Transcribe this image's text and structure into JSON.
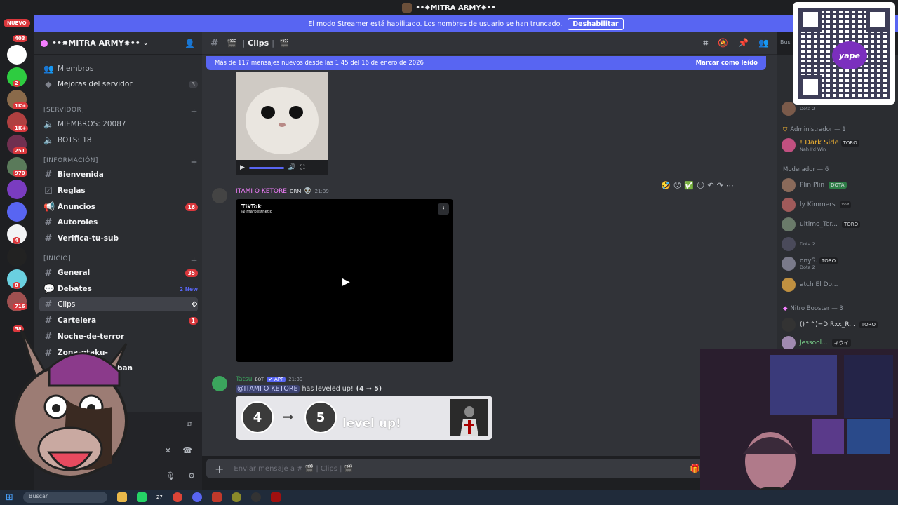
{
  "window": {
    "title": "••✸MITRA ARMY✸••"
  },
  "streamer_notice": {
    "text": "El modo Streamer está habilitado. Los nombres de usuario se han truncado.",
    "button": "Deshabilitar"
  },
  "rail": {
    "new_label": "NUEVO",
    "badges": [
      "403",
      "2",
      "1K+",
      "1K+",
      "251",
      "970",
      "4",
      "8",
      "716",
      "58"
    ]
  },
  "server": {
    "name": "••✸MITRA ARMY✸••"
  },
  "sidebar": {
    "top_items": [
      {
        "label": "Miembros"
      },
      {
        "label": "Mejoras del servidor",
        "count": "3"
      }
    ],
    "categories": {
      "servidor": "[SERVIDOR]",
      "informacion": "[INFORMACIÓN]",
      "inicio": "[INICIO]"
    },
    "servidor_items": [
      {
        "label": "MIEMBROS: 20087"
      },
      {
        "label": "BOTS: 18"
      }
    ],
    "info_channels": [
      {
        "emoji": "👋",
        "label": "Bienvenida"
      },
      {
        "emoji": "⛔",
        "label": "Reglas"
      },
      {
        "emoji": "◀",
        "label": "Anuncios",
        "count": "16"
      },
      {
        "emoji": "🗒",
        "label": "Autoroles"
      },
      {
        "emoji": "✅",
        "label": "Verifica-tu-sub"
      }
    ],
    "inicio_channels": [
      {
        "emoji": "🔵",
        "label": "General",
        "count": "35"
      },
      {
        "emoji": "",
        "label": "Debates",
        "new": "2 New"
      },
      {
        "emoji": "🎬",
        "label": "Clips"
      },
      {
        "emoji": "🍿",
        "label": "Cartelera",
        "count": "1"
      },
      {
        "emoji": "",
        "label": "Noche-de-terror"
      },
      {
        "emoji": "",
        "label": "Zona-otaku-"
      },
      {
        "emoji": "",
        "label": "unban"
      }
    ]
  },
  "chat_header": {
    "channel": "Clips",
    "search_placeholder": "Bus"
  },
  "new_messages_bar": {
    "text": "Más de 117 mensajes nuevos desde las 1:45 del 16 de enero de 2026",
    "mark": "Marcar como leído"
  },
  "message_tiktok": {
    "author": "ITAMI O KETORE",
    "badge": "ORM",
    "time": "21:39",
    "tiktok_brand": "TikTok",
    "tiktok_user": "@ marpesthetic"
  },
  "message_tatsu": {
    "author": "Tatsu",
    "bot_tag": "BOT",
    "app_tag": "✔ APP",
    "time": "21:39",
    "mention": "@ITAMI O KETORE",
    "text": "has leveled up!",
    "detail": "(4 → 5)",
    "level_from": "4",
    "level_to": "5",
    "level_text": "level up!"
  },
  "composer": {
    "placeholder": "Enviar mensaje a # 🎬 | Clips | 🎬"
  },
  "members": {
    "groups": [
      {
        "label": "Administrador — 1"
      },
      {
        "label": "Moderador — 6"
      },
      {
        "label": "Nitro Booster — 3"
      }
    ],
    "list": [
      {
        "name": "! Dark Side",
        "tag": "TORO",
        "sub": "Nah I'd Win",
        "color": "#f0b232"
      },
      {
        "name": "Plin Plin",
        "tag": "DOTA",
        "sub": "",
        "color": "#949ba4"
      },
      {
        "name": "ly Kimmers",
        "tag": "ᵈᵒᵗᵃ",
        "sub": "",
        "color": "#949ba4"
      },
      {
        "name": "ultimo_Ter...",
        "tag": "TORO",
        "sub": "",
        "color": "#949ba4"
      },
      {
        "name": "",
        "tag": "",
        "sub": "Dota 2",
        "color": "#949ba4"
      },
      {
        "name": "onyS.",
        "tag": "TORO",
        "sub": "Dota 2",
        "color": "#949ba4"
      },
      {
        "name": "atch El Do...",
        "tag": "",
        "sub": "",
        "color": "#949ba4"
      },
      {
        "name": "()^^)=D Rxx_R...",
        "tag": "TORO",
        "sub": "",
        "color": "#dbdee1"
      },
      {
        "name": "Jessool...",
        "tag": "キウイ",
        "sub": "",
        "color": "#7bd48c"
      }
    ],
    "top_sub": "Dota 2"
  },
  "qr": {
    "brand": "yape"
  },
  "taskbar": {
    "search": "Buscar",
    "badge": "27"
  }
}
